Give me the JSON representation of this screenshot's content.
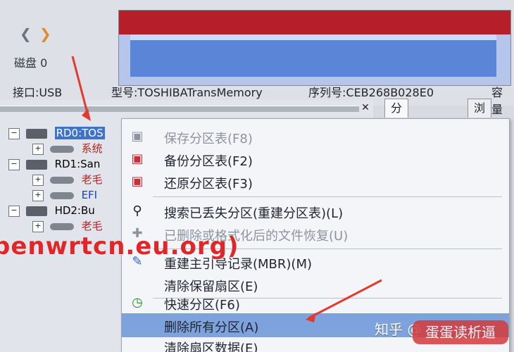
{
  "colors": {
    "arrow_red": "#e23a2f",
    "selection_blue": "#3f72c8",
    "menu_highlight": "#7ea2dd",
    "disk_red": "#b61e2a",
    "disk_blue": "#5b86d8"
  },
  "toolbar": {
    "back_icon": "chevron-left-icon",
    "forward_icon": "chevron-right-icon",
    "disk_label": "磁盘 0"
  },
  "info_bar": {
    "interface": "接口:USB",
    "model": "型号:TOSHIBATransMemory",
    "serial": "序列号:CEB268B028E0",
    "capacity": "容量"
  },
  "tabs": [
    {
      "label": "分区参数"
    },
    {
      "label": "浏览"
    }
  ],
  "tree": {
    "rows": [
      {
        "label": "RD0:TOS"
      },
      {
        "label": "系统"
      },
      {
        "label": "RD1:San"
      },
      {
        "label": "老毛"
      },
      {
        "label": "EFI"
      },
      {
        "label": "HD2:Bu"
      },
      {
        "label": "老毛"
      }
    ]
  },
  "menu": {
    "items": [
      {
        "label": "保存分区表(F8)",
        "icon": "save-icon",
        "disabled": true
      },
      {
        "label": "备份分区表(F2)",
        "icon": "backup-icon",
        "disabled": false
      },
      {
        "label": "还原分区表(F3)",
        "icon": "restore-icon",
        "disabled": false
      },
      {
        "label": "搜索已丢失分区(重建分区表)(L)",
        "icon": "search-icon",
        "disabled": false
      },
      {
        "label": "已删除或格式化后的文件恢复(U)",
        "icon": "recover-icon",
        "disabled": true
      },
      {
        "label": "重建主引导记录(MBR)(M)",
        "icon": "mbr-icon",
        "disabled": false
      },
      {
        "label": "清除保留扇区(E)",
        "icon": "",
        "disabled": false
      },
      {
        "label": "快速分区(F6)",
        "icon": "clock-icon",
        "disabled": false
      },
      {
        "label": "删除所有分区(A)",
        "icon": "",
        "disabled": false,
        "highlighted": true
      },
      {
        "label": "清除扇区数据(E)",
        "icon": "",
        "disabled": false
      }
    ]
  },
  "watermark": {
    "text": "penwrtcn.eu.org)",
    "zhihu": "知乎 @",
    "logo_text": "蛋蛋读析逼"
  }
}
